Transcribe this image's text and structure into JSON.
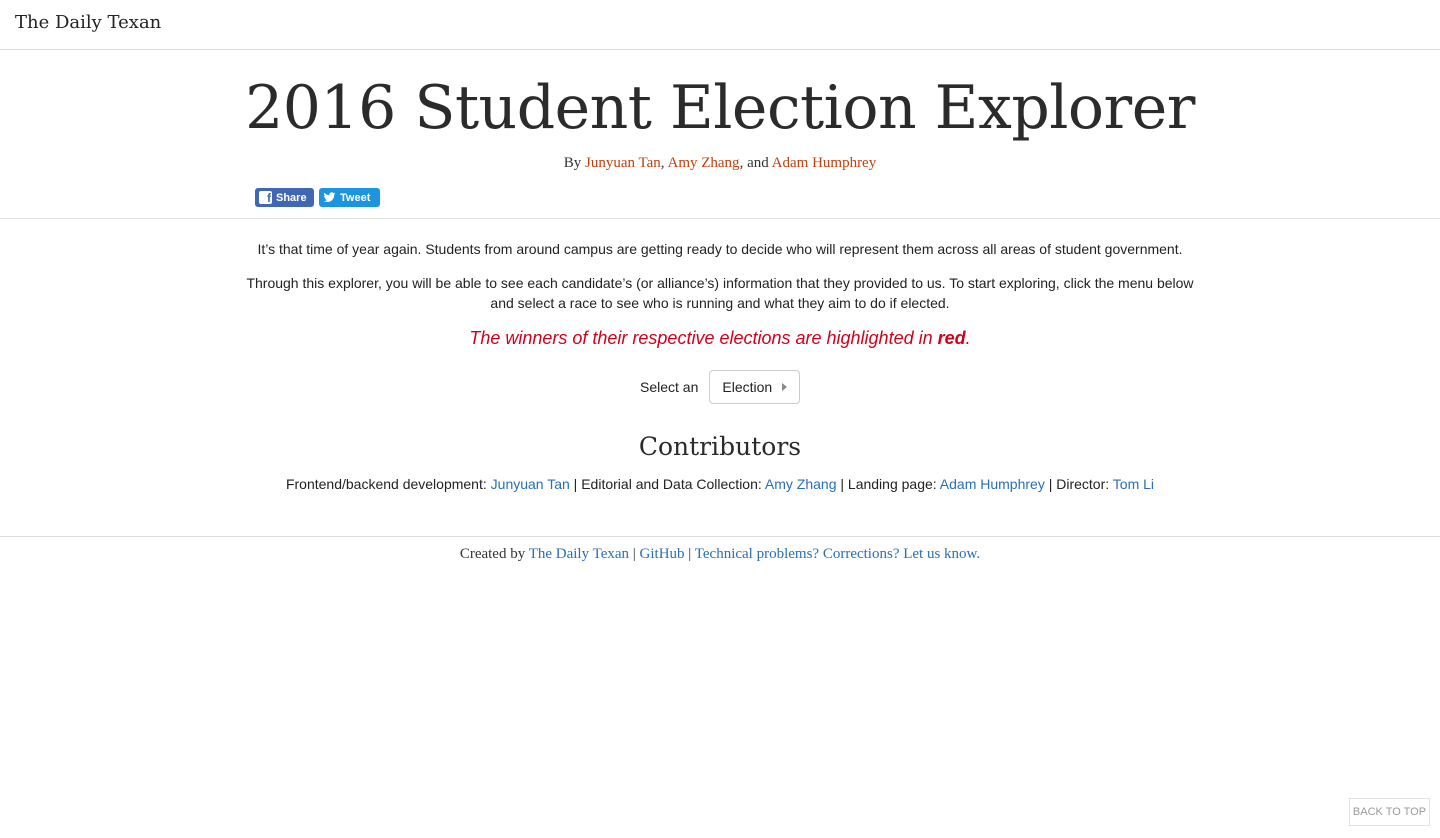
{
  "header": {
    "brand": "The Daily Texan"
  },
  "title": "2016 Student Election Explorer",
  "byline": {
    "prefix": "By ",
    "authors": [
      "Junyuan Tan",
      "Amy Zhang",
      "Adam Humphrey"
    ],
    "sep1": ", ",
    "sep2": ", and "
  },
  "social": {
    "share_label": "Share",
    "tweet_label": "Tweet",
    "share_icon_glyph": "f",
    "share_icon": "facebook-icon",
    "tweet_icon": "twitter-bird-icon",
    "share_color": "#4267b2",
    "tweet_color": "#1b95e0"
  },
  "intro": {
    "paragraph1": "It’s that time of year again. Students from around campus are getting ready to decide who will represent them across all areas of student government.",
    "paragraph2": "Through this explorer, you will be able to see each candidate’s (or alliance’s) information that they provided to us. To start exploring, click the menu below and select a race to see who is running and what they aim to do if elected."
  },
  "winners_note": {
    "before": "The winners of their respective elections are highlighted in ",
    "emphasis": "red",
    "after": ".",
    "color": "#d0021b"
  },
  "selector": {
    "label": "Select an",
    "button_label": "Election",
    "icon": "caret-right-icon"
  },
  "contributors": {
    "heading": "Contributors",
    "roles": [
      {
        "role": "Frontend/backend development: ",
        "name": "Junyuan Tan"
      },
      {
        "role": "Editorial and Data Collection: ",
        "name": "Amy Zhang"
      },
      {
        "role": "Landing page: ",
        "name": "Adam Humphrey"
      },
      {
        "role": "Director: ",
        "name": "Tom Li"
      }
    ],
    "separator": " | "
  },
  "footer": {
    "prefix": "Created by ",
    "links": [
      "The Daily Texan",
      "GitHub",
      "Technical problems? Corrections? Let us know."
    ],
    "separator": " | "
  },
  "back_to_top": "BACK TO TOP",
  "colors": {
    "author_link": "#c2410c",
    "link_blue": "#2a6fb5"
  }
}
